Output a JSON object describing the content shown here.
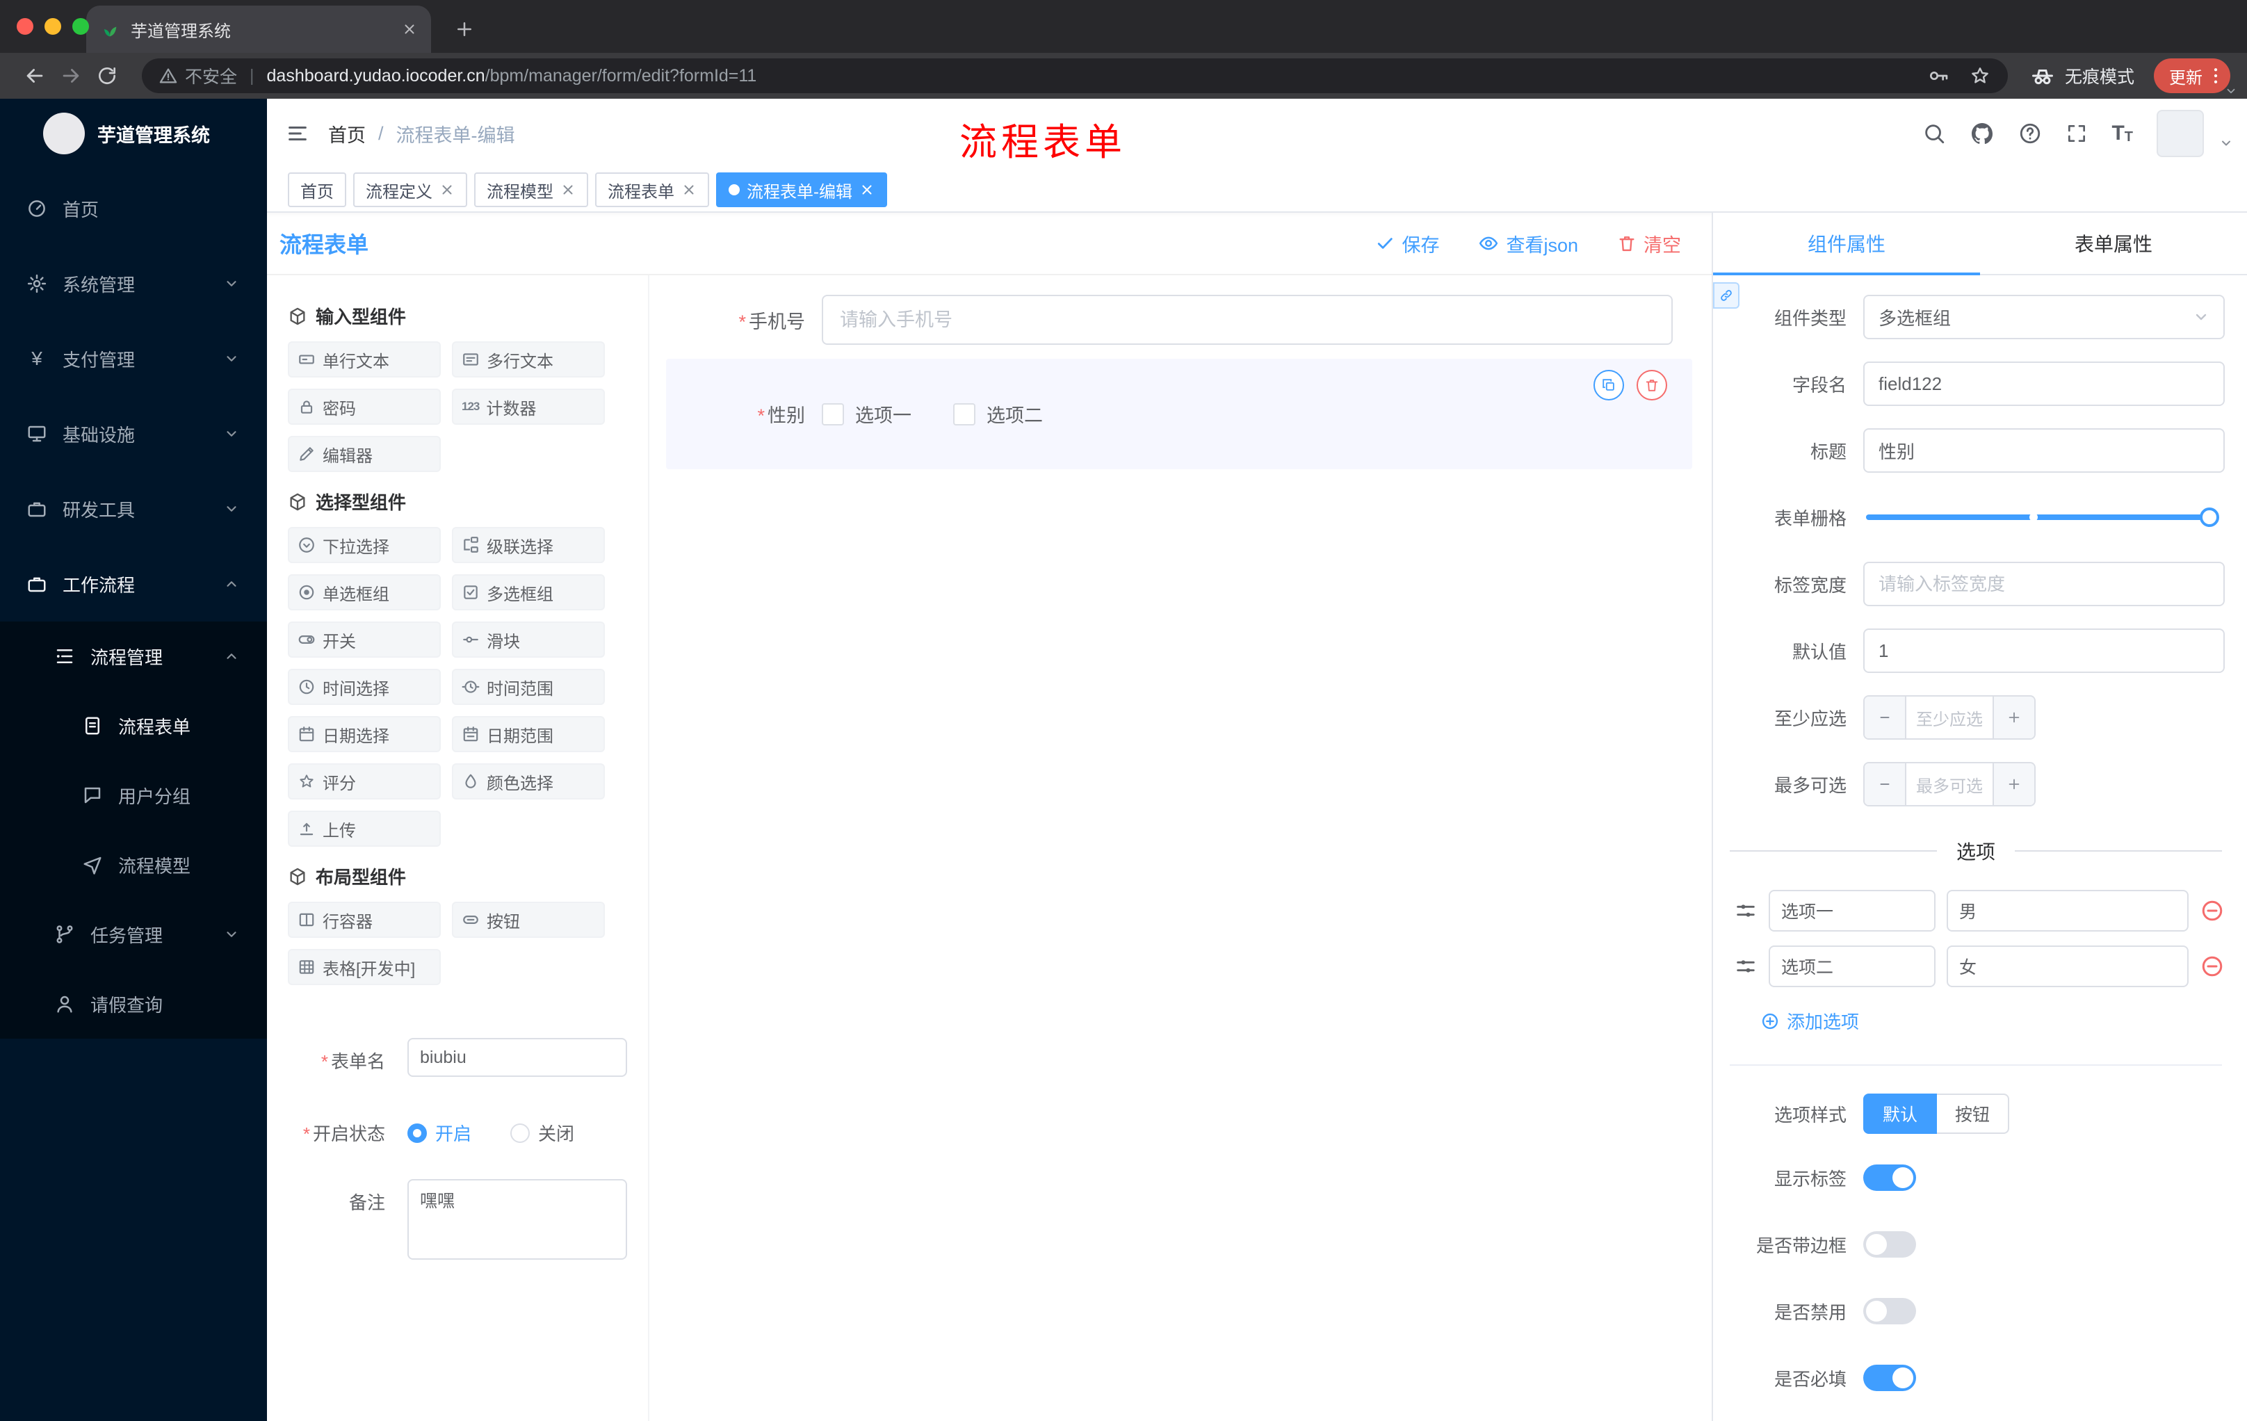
{
  "colors": {
    "accent": "#409eff",
    "danger": "#f56c6c",
    "sidebar_bg": "#001529",
    "annotation": "#fe0100",
    "tag_active_bg": "#409eff",
    "update_pill": "#d75248"
  },
  "browser": {
    "tab_title": "芋道管理系统",
    "security_label": "不安全",
    "url_domain": "dashboard.yudao.iocoder.cn",
    "url_path": "/bpm/manager/form/edit?formId=11",
    "incognito_label": "无痕模式",
    "update_label": "更新"
  },
  "sidebar": {
    "logo_title": "芋道管理系统",
    "yen_glyph": "¥",
    "items": [
      {
        "label": "首页"
      },
      {
        "label": "系统管理"
      },
      {
        "label": "支付管理"
      },
      {
        "label": "基础设施"
      },
      {
        "label": "研发工具"
      },
      {
        "label": "工作流程"
      },
      {
        "label": "流程管理"
      },
      {
        "label": "流程表单"
      },
      {
        "label": "用户分组"
      },
      {
        "label": "流程模型"
      },
      {
        "label": "任务管理"
      },
      {
        "label": "请假查询"
      }
    ]
  },
  "header": {
    "breadcrumb": {
      "home": "首页",
      "separator": "/",
      "current": "流程表单-编辑"
    },
    "annotation": "流程表单",
    "text_size_glyph": "T"
  },
  "tags": {
    "items": [
      {
        "label": "首页"
      },
      {
        "label": "流程定义"
      },
      {
        "label": "流程模型"
      },
      {
        "label": "流程表单"
      },
      {
        "label": "流程表单-编辑"
      }
    ]
  },
  "designer": {
    "title": "流程表单",
    "required_mark": "*",
    "toolbar": {
      "save": "保存",
      "view_json": "查看json",
      "clear": "清空"
    },
    "palette": {
      "groups": [
        {
          "title": "输入型组件",
          "items": [
            {
              "label": "单行文本"
            },
            {
              "label": "多行文本"
            },
            {
              "label": "密码"
            },
            {
              "label": "计数器",
              "glyph": "123"
            },
            {
              "label": "编辑器"
            }
          ]
        },
        {
          "title": "选择型组件",
          "items": [
            {
              "label": "下拉选择"
            },
            {
              "label": "级联选择"
            },
            {
              "label": "单选框组"
            },
            {
              "label": "多选框组"
            },
            {
              "label": "开关"
            },
            {
              "label": "滑块"
            },
            {
              "label": "时间选择"
            },
            {
              "label": "时间范围"
            },
            {
              "label": "日期选择"
            },
            {
              "label": "日期范围"
            },
            {
              "label": "评分"
            },
            {
              "label": "颜色选择"
            },
            {
              "label": "上传"
            }
          ]
        },
        {
          "title": "布局型组件",
          "items": [
            {
              "label": "行容器"
            },
            {
              "label": "按钮"
            },
            {
              "label": "表格[开发中]"
            }
          ]
        }
      ]
    },
    "form_meta": {
      "name_label": "表单名",
      "name_value": "biubiu",
      "status_label": "开启状态",
      "status_on": "开启",
      "status_off": "关闭",
      "remark_label": "备注",
      "remark_value": "嘿嘿"
    },
    "canvas": {
      "phone": {
        "label": "手机号",
        "placeholder": "请输入手机号"
      },
      "gender": {
        "label": "性别",
        "option1": "选项一",
        "option2": "选项二"
      }
    }
  },
  "props": {
    "tabs": {
      "component": "组件属性",
      "form": "表单属性"
    },
    "component_type": {
      "label": "组件类型",
      "value": "多选框组"
    },
    "field_name": {
      "label": "字段名",
      "value": "field122"
    },
    "title": {
      "label": "标题",
      "value": "性别"
    },
    "grid": {
      "label": "表单栅格"
    },
    "label_width": {
      "label": "标签宽度",
      "placeholder": "请输入标签宽度"
    },
    "default_value": {
      "label": "默认值",
      "value": "1"
    },
    "min_select": {
      "label": "至少应选",
      "placeholder": "至少应选"
    },
    "max_select": {
      "label": "最多可选",
      "placeholder": "最多可选"
    },
    "options_title": "选项",
    "options": [
      {
        "name": "选项一",
        "value": "男"
      },
      {
        "name": "选项二",
        "value": "女"
      }
    ],
    "add_option": "添加选项",
    "option_style": {
      "label": "选项样式",
      "default": "默认",
      "button": "按钮"
    },
    "toggles": [
      {
        "label": "显示标签",
        "on": true
      },
      {
        "label": "是否带边框",
        "on": false
      },
      {
        "label": "是否禁用",
        "on": false
      },
      {
        "label": "是否必填",
        "on": true
      }
    ]
  }
}
